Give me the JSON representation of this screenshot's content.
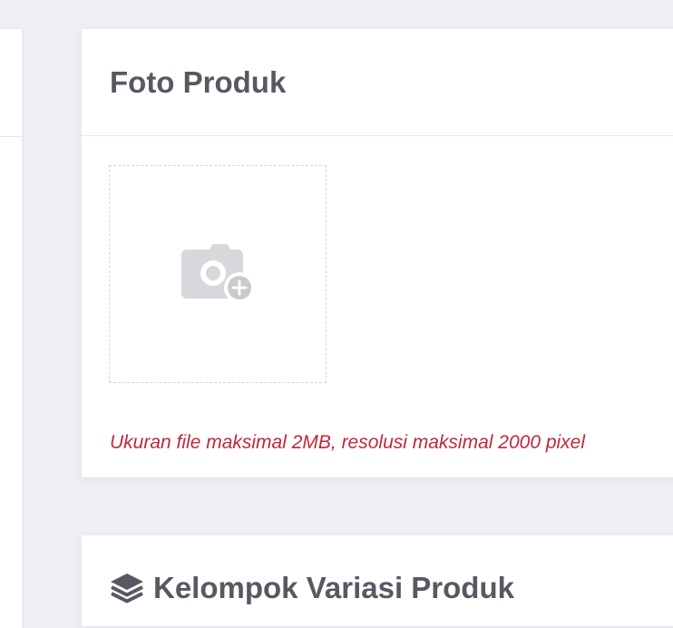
{
  "photo_section": {
    "title": "Foto Produk",
    "upload_icon": "add-photo-icon",
    "note": "Ukuran file maksimal 2MB, resolusi maksimal 2000 pixel",
    "note_color": "#c1283a"
  },
  "variant_section": {
    "icon": "layers-icon",
    "title": "Kelompok Variasi Produk"
  }
}
